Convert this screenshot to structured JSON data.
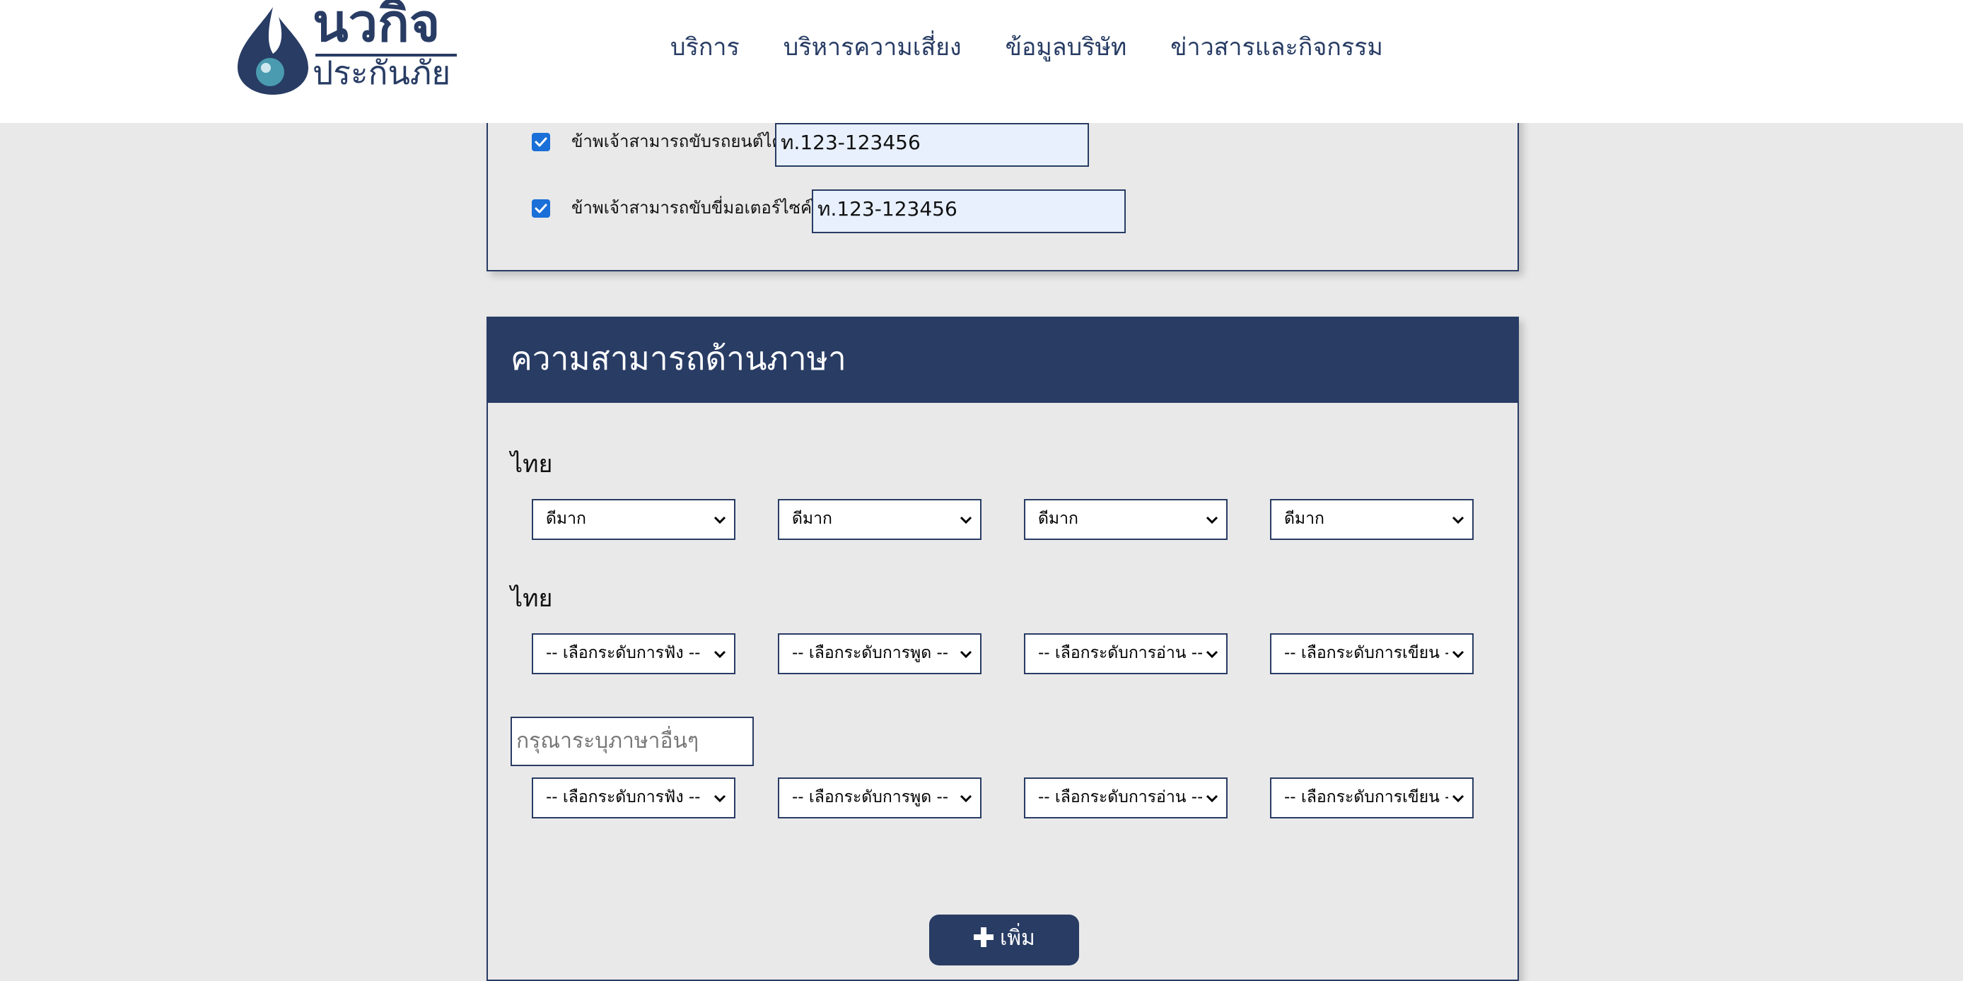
{
  "brand": {
    "name_top": "นวกิจ",
    "name_bottom": "ประกันภัย",
    "color_primary": "#283c64",
    "color_droplet": "#4a9bb0"
  },
  "nav": {
    "items": [
      {
        "label": "บริการ"
      },
      {
        "label": "บริหารความเสี่ยง"
      },
      {
        "label": "ข้อมูลบริษัท"
      },
      {
        "label": "ข่าวสารและกิจกรรม"
      }
    ]
  },
  "license": {
    "car": {
      "checked": true,
      "label": "ข้าพเจ้าสามารถขับรถยนต์ได้",
      "value": "ท.123-123456"
    },
    "motorcycle": {
      "checked": true,
      "label": "ข้าพเจ้าสามารถขับขี่มอเตอร์ไซค์ได้",
      "value": "ท.123-123456"
    }
  },
  "language": {
    "title": "ความสามารถด้านภาษา",
    "rows": [
      {
        "label": "ไทย",
        "selects": [
          "ดีมาก",
          "ดีมาก",
          "ดีมาก",
          "ดีมาก"
        ]
      },
      {
        "label": "ไทย",
        "selects": [
          "-- เลือกระดับการฟัง --",
          "-- เลือกระดับการพูด --",
          "-- เลือกระดับการอ่าน --",
          "-- เลือกระดับการเขียน --"
        ]
      },
      {
        "selects": [
          "-- เลือกระดับการฟัง --",
          "-- เลือกระดับการพูด --",
          "-- เลือกระดับการอ่าน --",
          "-- เลือกระดับการเขียน --"
        ]
      }
    ],
    "other_placeholder": "กรุณาระบุภาษาอื่นๆ",
    "add_label": "เพิ่ม"
  }
}
